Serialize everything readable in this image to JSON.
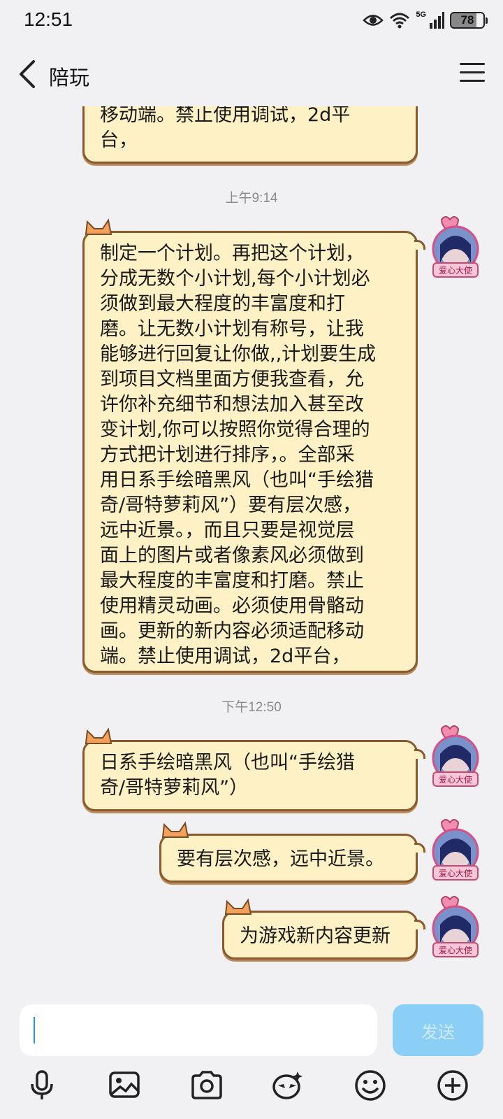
{
  "status_bar": {
    "time": "12:51",
    "network_label": "5G",
    "battery": "78",
    "icons": [
      "eye-icon",
      "wifi-icon",
      "signal-icon",
      "battery-icon"
    ]
  },
  "header": {
    "title": "陪玩",
    "back_icon": "chevron-left-icon",
    "menu_icon": "hamburger-menu-icon"
  },
  "messages": [
    {
      "text": "移动端。禁止使用调试，2d平\n台，"
    },
    {
      "timestamp": "上午9:14"
    },
    {
      "text": "制定一个计划。再把这个计划，\n分成无数个小计划,每个小计划必\n须做到最大程度的丰富度和打\n磨。让无数小计划有称号，让我\n能够进行回复让你做,,计划要生成\n到项目文档里面方便我查看，允\n许你补充细节和想法加入甚至改\n变计划,你可以按照你觉得合理的\n方式把计划进行排序，。全部采\n用日系手绘暗黑风（也叫“手绘猎\n奇/哥特萝莉风”）要有层次感，\n远中近景。，而且只要是视觉层\n面上的图片或者像素风必须做到\n最大程度的丰富度和打磨。禁止\n使用精灵动画。必须使用骨骼动\n画。更新的新内容必须适配移动\n端。禁止使用调试，2d平台，"
    },
    {
      "timestamp": "下午12:50"
    },
    {
      "text": "日系手绘暗黑风（也叫“手绘猎\n奇/哥特萝莉风”）"
    },
    {
      "text": "要有层次感，远中近景。"
    },
    {
      "text": "为游戏新内容更新"
    }
  ],
  "avatar_badge": "爱心大使",
  "input": {
    "value": "",
    "send_label": "发送"
  },
  "toolbar": [
    "microphone-icon",
    "image-icon",
    "camera-icon",
    "sticker-icon",
    "emoji-icon",
    "plus-icon"
  ],
  "colors": {
    "background": "#f1f1f4",
    "bubble_fill": "#fdf1c5",
    "bubble_border": "#8a5a2f",
    "send_button": "#8ccff6",
    "timestamp": "#8a8a8a"
  }
}
